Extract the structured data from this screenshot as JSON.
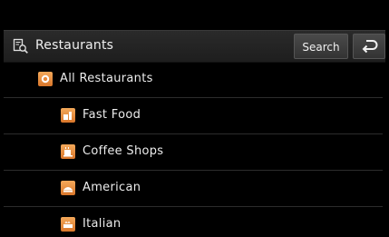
{
  "header": {
    "title": "Restaurants",
    "search_label": "Search",
    "title_icon": "poi-search-icon",
    "back_icon": "back-arrow-icon"
  },
  "list": {
    "items": [
      {
        "label": "All Restaurants",
        "icon": "restaurant-plate-icon"
      },
      {
        "label": "Fast Food",
        "icon": "fast-food-icon"
      },
      {
        "label": "Coffee Shops",
        "icon": "coffee-cup-icon"
      },
      {
        "label": "American",
        "icon": "american-food-icon"
      },
      {
        "label": "Italian",
        "icon": "italian-food-icon"
      }
    ]
  },
  "colors": {
    "accent_orange": "#e8893a",
    "header_bg": "#2a2a2a",
    "background": "#000000"
  }
}
